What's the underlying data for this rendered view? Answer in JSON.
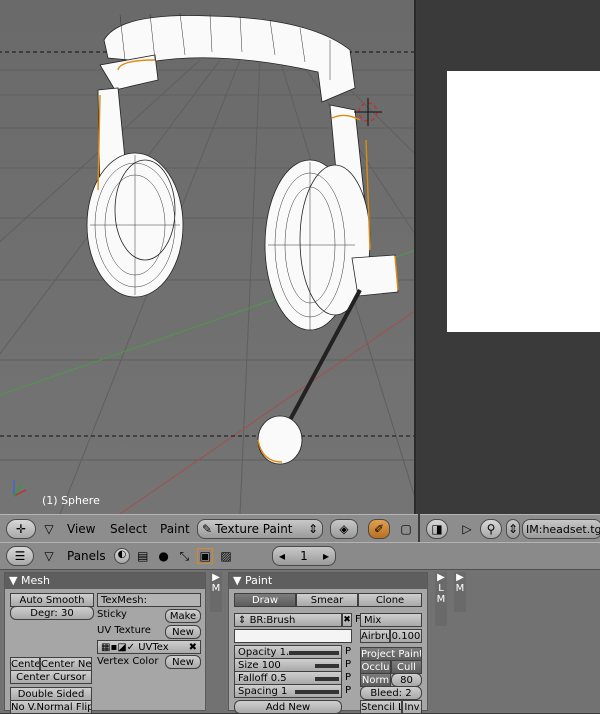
{
  "viewport": {
    "object_label": "(1) Sphere"
  },
  "viewport_header": {
    "menus": [
      "View",
      "Select",
      "Paint"
    ],
    "mode": "Texture Paint"
  },
  "image_header": {
    "image_name": "IM:headset.tg"
  },
  "buttons_header": {
    "panels_label": "Panels",
    "frame": "1"
  },
  "mesh_panel": {
    "title": "Mesh",
    "auto_smooth": "Auto Smooth",
    "degr": "Degr: 30",
    "texmesh": "TexMesh:",
    "sticky": "Sticky",
    "make": "Make",
    "uv_texture": "UV Texture",
    "new1": "New",
    "uvtex": "UVTex",
    "vertex_color": "Vertex Color",
    "new2": "New",
    "centre": "Cente",
    "center_new": "Center Ne",
    "center_cursor": "Center Cursor",
    "double_sided": "Double Sided",
    "no_v_normal_flip": "No V.Normal Flip",
    "tab_m": "M"
  },
  "paint_panel": {
    "title": "Paint",
    "tabs": [
      "Draw",
      "Smear",
      "Clone"
    ],
    "brush": "BR:Brush",
    "f": "F",
    "mix": "Mix",
    "airbrush": "Airbru",
    "airbrush_val": "0.100",
    "opacity": "Opacity 1.",
    "size": "Size 100",
    "falloff": "Falloff 0.5",
    "spacing": "Spacing 1",
    "p": "P",
    "project_paint": "Project Paint",
    "occlu": "Occlu",
    "cull": "Cull",
    "norm": "Norm",
    "norm_val": "80",
    "bleed": "Bleed: 2",
    "add_new": "Add New",
    "stencil": "Stencil La",
    "inv": "Inv",
    "tab_m": "M",
    "tab_l": "L",
    "tab_m2": "M"
  }
}
